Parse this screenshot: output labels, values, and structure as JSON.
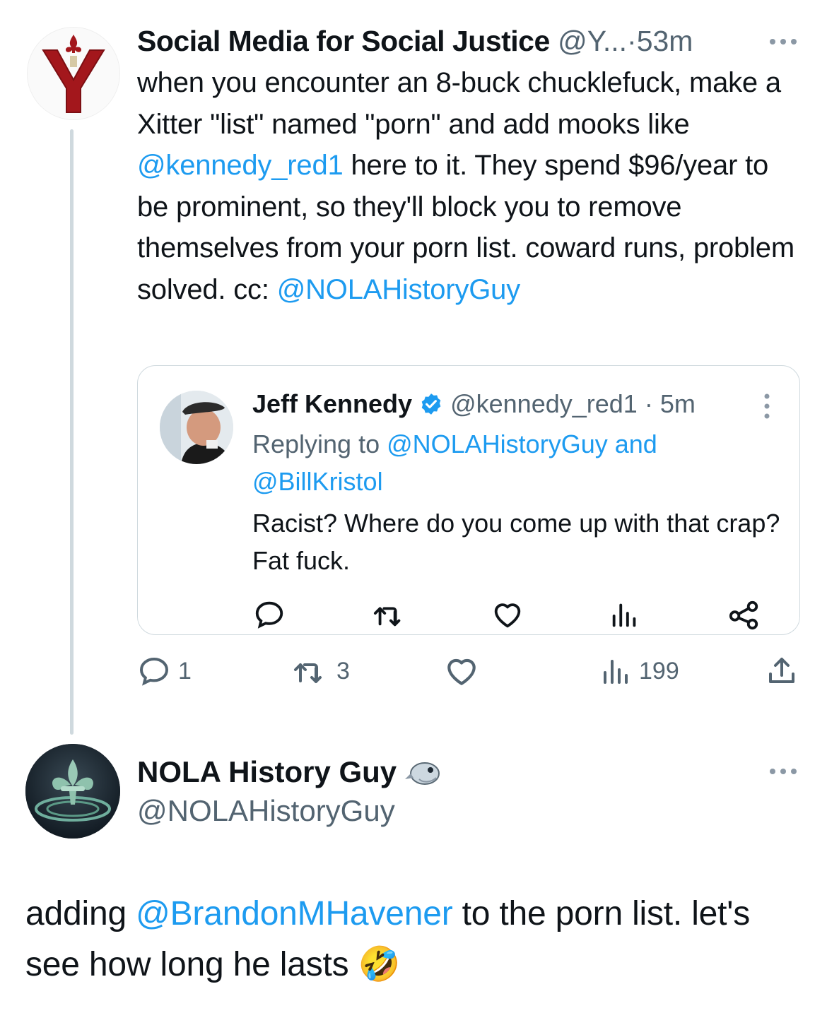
{
  "tweet1": {
    "display_name": "Social Media for Social Justice",
    "handle": "@Y...",
    "separator": "·",
    "time": "53m",
    "body": [
      {
        "text": "when you encounter an 8-buck chucklefuck, make a Xitter \"list\" named \"porn\" and add mooks like ",
        "link": false
      },
      {
        "text": "@kennedy_red1",
        "link": true
      },
      {
        "text": " here to it. They spend $96/year to be prominent, so they'll block you to remove themselves from your porn list. coward runs, problem solved. cc: ",
        "link": false
      },
      {
        "text": "@NOLAHistoryGuy",
        "link": true
      }
    ],
    "quoted": {
      "display_name": "Jeff Kennedy",
      "handle": "@kennedy_red1",
      "separator": "·",
      "time": "5m",
      "replying_prefix": "Replying to ",
      "replying_to_1": "@NOLAHistoryGuy",
      "replying_and": " and",
      "replying_to_2": "@BillKristol",
      "text": "Racist? Where do you come up with that crap? Fat fuck."
    },
    "actions": {
      "replies": "1",
      "retweets": "3",
      "views": "199"
    }
  },
  "tweet2": {
    "display_name": "NOLA History Guy",
    "handle": "@NOLAHistoryGuy",
    "body_prefix": "adding ",
    "body_link": "@BrandonMHavener",
    "body_suffix": " to the porn list. let's see how long he lasts ",
    "emoji": "🤣"
  },
  "colors": {
    "link": "#1d9bf0",
    "muted": "#536471",
    "verified": "#1d9bf0",
    "avatar_red": "#a3171c",
    "border": "#cfd9de"
  },
  "icons": {
    "more": "more-horizontal-icon",
    "reply": "reply-bubble-icon",
    "retweet": "retweet-icon",
    "like": "heart-icon",
    "views": "views-bar-chart-icon",
    "share": "share-upload-icon",
    "share_quoted": "share-nodes-icon",
    "verified": "verified-badge-icon",
    "bird": "bird-icon"
  }
}
